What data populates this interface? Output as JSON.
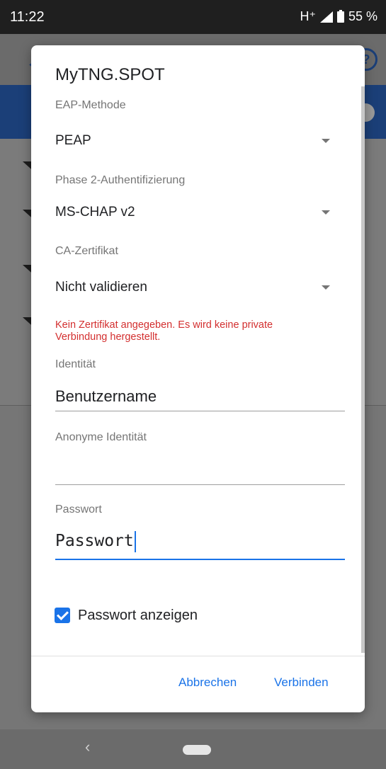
{
  "status_bar": {
    "time": "11:22",
    "network": "H⁺",
    "battery": "55 %"
  },
  "dialog": {
    "title": "MyTNG.SPOT",
    "eap_method": {
      "label": "EAP-Methode",
      "value": "PEAP"
    },
    "phase2": {
      "label": "Phase 2-Authentifizierung",
      "value": "MS-CHAP v2"
    },
    "ca_cert": {
      "label": "CA-Zertifikat",
      "value": "Nicht validieren"
    },
    "warning": "Kein Zertifikat angegeben. Es wird keine private Verbindung hergestellt.",
    "identity": {
      "label": "Identität",
      "value": "Benutzername"
    },
    "anon_identity": {
      "label": "Anonyme Identität",
      "value": ""
    },
    "password": {
      "label": "Passwort",
      "value": "Passwort"
    },
    "show_password": {
      "label": "Passwort anzeigen",
      "checked": true
    },
    "cancel_label": "Abbrechen",
    "connect_label": "Verbinden"
  },
  "colors": {
    "accent": "#1a73e8",
    "warning": "#d32f2f"
  },
  "icons": [
    "signal-icon",
    "battery-icon",
    "dropdown-arrow-icon",
    "checkbox-checked-icon",
    "nav-back-icon",
    "nav-home-icon"
  ]
}
